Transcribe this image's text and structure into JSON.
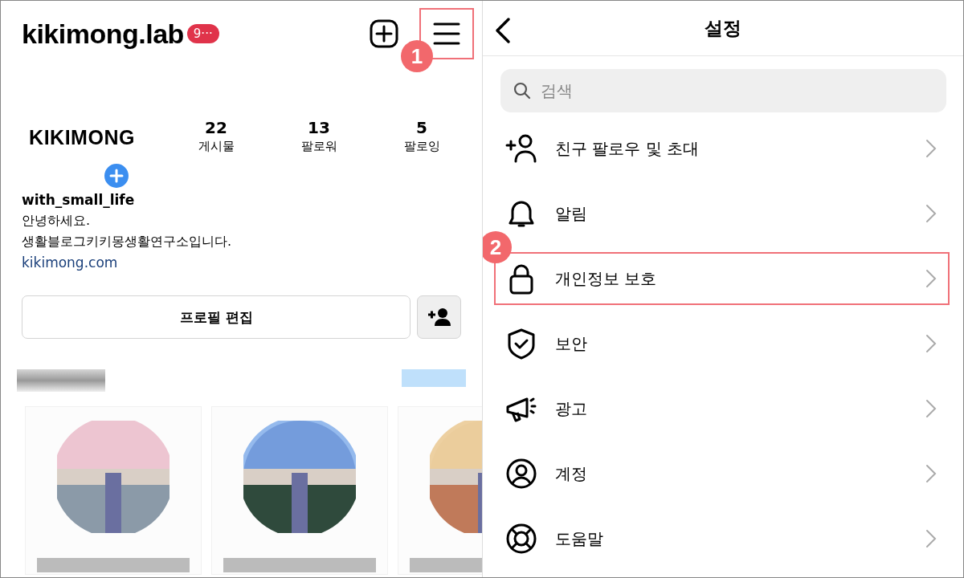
{
  "profile": {
    "username": "kikimong.lab",
    "badge": "9···",
    "menu_step": "1",
    "avatar_text": "KIKIMONG",
    "stats": [
      {
        "value": "22",
        "label": "게시물"
      },
      {
        "value": "13",
        "label": "팔로워"
      },
      {
        "value": "5",
        "label": "팔로잉"
      }
    ],
    "name": "with_small_life",
    "bio": [
      "안녕하세요.",
      "생활블로그키키몽생활연구소입니다."
    ],
    "link": "kikimong.com",
    "edit_button": "프로필 편집",
    "cards": [
      {
        "kind": "picture"
      },
      {
        "kind": "picture"
      },
      {
        "kind": "picture"
      }
    ]
  },
  "settings": {
    "title": "설정",
    "search": {
      "placeholder": "검색"
    },
    "items": [
      {
        "label": "친구 팔로우 및 초대",
        "kind": "add-person",
        "highlighted": false
      },
      {
        "label": "알림",
        "kind": "bell",
        "highlighted": false
      },
      {
        "label": "개인정보 보호",
        "kind": "lock",
        "highlighted": true,
        "step": "2"
      },
      {
        "label": "보안",
        "kind": "shield",
        "highlighted": false
      },
      {
        "label": "광고",
        "kind": "megaphone",
        "highlighted": false
      },
      {
        "label": "계정",
        "kind": "account",
        "highlighted": false
      },
      {
        "label": "도움말",
        "kind": "help",
        "highlighted": false
      }
    ]
  }
}
